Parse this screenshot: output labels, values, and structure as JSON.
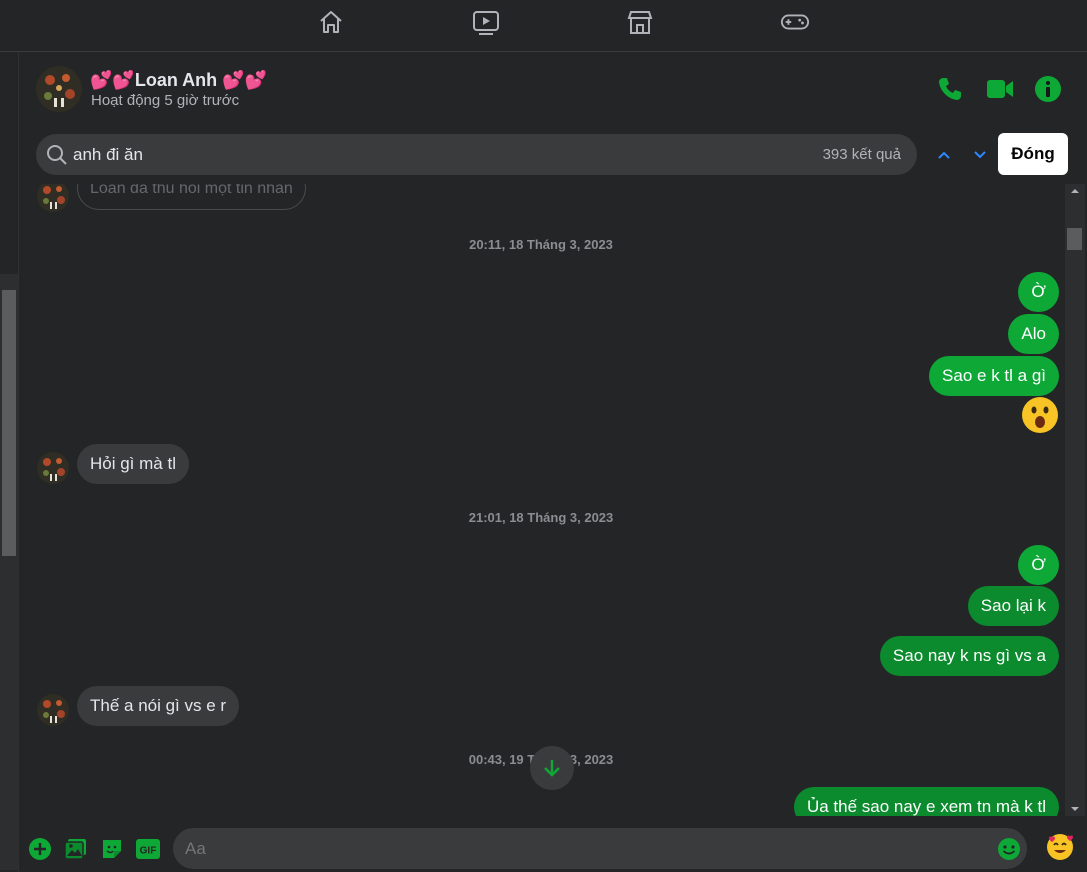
{
  "topnav": {
    "items": [
      {
        "name": "home-icon"
      },
      {
        "name": "watch-icon"
      },
      {
        "name": "marketplace-icon"
      },
      {
        "name": "gaming-icon"
      }
    ]
  },
  "header": {
    "contact_name": "💕💕Loan Anh 💕💕",
    "status": "Hoạt động 5 giờ trước",
    "accent": "#0ea837"
  },
  "search": {
    "query": "anh đi ăn",
    "result_count": "393 kết quả",
    "close_label": "Đóng"
  },
  "messages": {
    "unsent_notice": "Loan đã thu hồi một tin nhắn",
    "timestamps": [
      "20:11, 18 Tháng 3, 2023",
      "21:01, 18 Tháng 3, 2023",
      "00:43, 19 Tháng 3, 2023"
    ],
    "items": [
      {
        "side": "out",
        "text": "Ờ"
      },
      {
        "side": "out",
        "text": "Alo"
      },
      {
        "side": "out",
        "text": "Sao e k tl a gì"
      },
      {
        "side": "out",
        "emoji": "😮"
      },
      {
        "side": "in",
        "text": "Hỏi gì mà tl"
      },
      {
        "side": "out",
        "text": "Ờ"
      },
      {
        "side": "out",
        "text": "Sao lại k"
      },
      {
        "side": "out",
        "text": "Sao nay k ns gì vs a"
      },
      {
        "side": "in",
        "text": "Thế a nói gì vs e r"
      },
      {
        "side": "out",
        "text": "Ủa thế sao nay e xem tn mà k tl"
      }
    ]
  },
  "composer": {
    "placeholder": "Aa",
    "quick_reaction": "🥰"
  },
  "colors": {
    "outgoing_bubble": "#0b8a2e",
    "incoming_bubble": "#3a3b3c",
    "background": "#242526"
  }
}
